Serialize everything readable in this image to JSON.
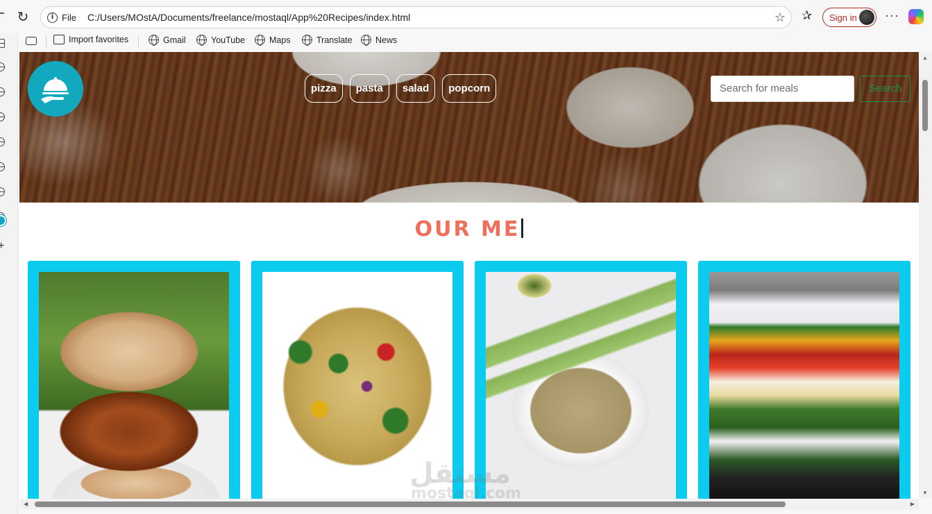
{
  "browser": {
    "file_label": "File",
    "url": "C:/Users/MOstA/Documents/freelance/mostaql/App%20Recipes/index.html",
    "sign_in_label": "Sign in",
    "more_label": "···"
  },
  "bookmarks": [
    {
      "label": "Import favorites"
    },
    {
      "label": "Gmail"
    },
    {
      "label": "YouTube"
    },
    {
      "label": "Maps"
    },
    {
      "label": "Translate"
    },
    {
      "label": "News"
    }
  ],
  "page": {
    "categories": [
      "pizza",
      "pasta",
      "salad",
      "popcorn"
    ],
    "search": {
      "placeholder": "Search for meals",
      "button_label": "Search"
    },
    "section_title": "OUR ME",
    "cards": [
      {
        "icon": "burger-photo"
      },
      {
        "icon": "pasta-salad-photo"
      },
      {
        "icon": "quinoa-salad-photo"
      },
      {
        "icon": "layered-jar-salad-photo"
      }
    ],
    "watermark_ar": "مستقل",
    "watermark_en": "mostaql.com"
  },
  "colors": {
    "accent": "#0bcbee",
    "title": "#ef6f5a",
    "logo": "#12a9bf",
    "search_button": "#1f8f4c"
  }
}
